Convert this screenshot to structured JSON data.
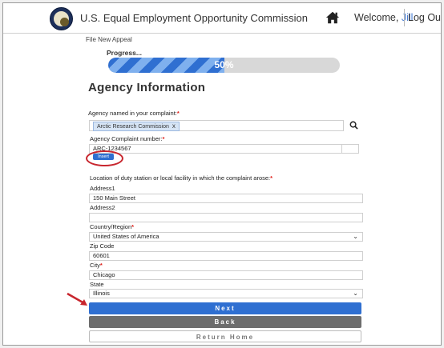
{
  "header": {
    "title": "U.S. Equal Employment Opportunity Commission",
    "welcome_label": "Welcome,",
    "username": "Jill",
    "logout_label": "Log Out"
  },
  "breadcrumb": "File New Appeal",
  "progress": {
    "label": "Progress...",
    "percent": 50,
    "text": "50%"
  },
  "section_title": "Agency Information",
  "agency_named": {
    "label": "Agency named in your complaint:",
    "required_mark": "*",
    "selected_tag": "Arctic Research Commission",
    "remove_glyph": "x"
  },
  "complaint_number": {
    "label": "Agency Complaint number:",
    "required_mark": "*",
    "value": "ARC-1234567",
    "insert_label": "Insert"
  },
  "location": {
    "label": "Location of duty station or local facility in which the complaint arose:",
    "required_mark": "*"
  },
  "address1": {
    "label": "Address1",
    "value": "150 Main Street"
  },
  "address2": {
    "label": "Address2",
    "value": ""
  },
  "country": {
    "label": "Country/Region",
    "required_mark": "*",
    "value": "United States of America"
  },
  "zip": {
    "label": "Zip Code",
    "value": "60601"
  },
  "city": {
    "label": "City",
    "required_mark": "*",
    "value": "Chicago"
  },
  "state": {
    "label": "State",
    "value": "Illinois"
  },
  "buttons": {
    "next": "Next",
    "back": "Back",
    "home": "Return Home"
  },
  "colors": {
    "primary": "#2f6fd1",
    "required": "#e0201a",
    "annotation": "#c8262e",
    "back_button": "#6d6d6d"
  }
}
